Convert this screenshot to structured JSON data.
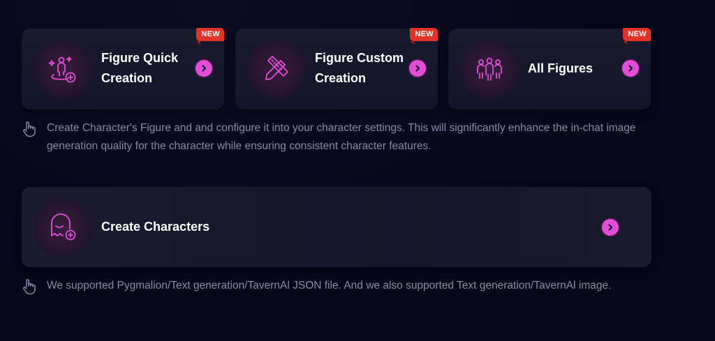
{
  "figure_cards": [
    {
      "label": "Figure Quick Creation",
      "badge": "NEW",
      "icon": "figure-quick-creation-icon"
    },
    {
      "label": "Figure Custom Creation",
      "badge": "NEW",
      "icon": "pencil-ruler-icon"
    },
    {
      "label": "All Figures",
      "badge": "NEW",
      "icon": "people-group-icon"
    }
  ],
  "figure_note": "Create Character's Figure and and configure it into your character settings. This will significantly enhance the in-chat image generation quality for the character while ensuring consistent character features.",
  "create_characters": {
    "label": "Create Characters",
    "icon": "ghost-add-icon"
  },
  "characters_note": "We supported Pygmalion/Text generation/TavernAl JSON file. And we also supported Text generation/TavernAl image.",
  "colors": {
    "accent": "#e24fd6",
    "badge": "#e33326",
    "background": "#07061a",
    "card": "#1a1a2e",
    "note_text": "#8a89a6"
  }
}
